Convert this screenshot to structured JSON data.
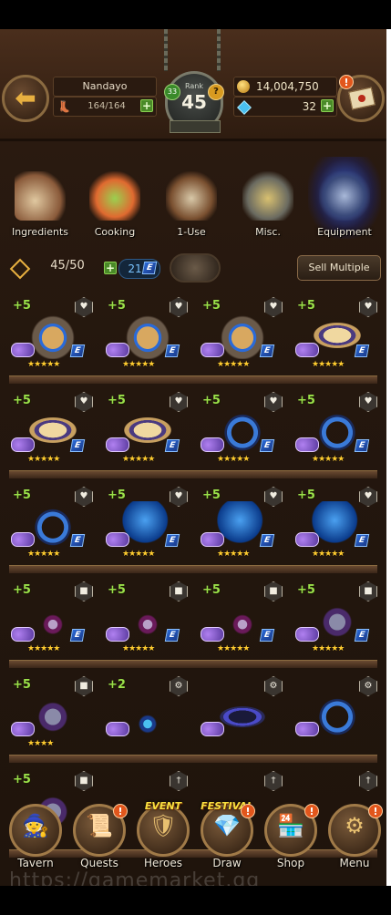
{
  "header": {
    "player_name": "Nandayo",
    "stamina": "164/164",
    "rank_label": "Rank",
    "rank": "45",
    "rank_badge_left": "33",
    "rank_badge_right": "?",
    "gold": "14,004,750",
    "gems": "32",
    "mail_alert": "!"
  },
  "categories": [
    {
      "label": "Ingredients"
    },
    {
      "label": "Cooking"
    },
    {
      "label": "1-Use"
    },
    {
      "label": "Misc."
    },
    {
      "label": "Equipment"
    }
  ],
  "inventory": {
    "slots": "45/50",
    "energy": "21",
    "energy_badge": "E",
    "sell_label": "Sell Multiple"
  },
  "items": [
    {
      "plus": "+5",
      "fav": "♥",
      "stars": "★★★★★",
      "type": "bracer"
    },
    {
      "plus": "+5",
      "fav": "♥",
      "stars": "★★★★★",
      "type": "bracer"
    },
    {
      "plus": "+5",
      "fav": "♥",
      "stars": "★★★★★",
      "type": "bracer"
    },
    {
      "plus": "+5",
      "fav": "♥",
      "stars": "★★★★★",
      "type": "belt"
    },
    {
      "plus": "+5",
      "fav": "♥",
      "stars": "★★★★★",
      "type": "belt"
    },
    {
      "plus": "+5",
      "fav": "♥",
      "stars": "★★★★★",
      "type": "belt"
    },
    {
      "plus": "+5",
      "fav": "♥",
      "stars": "★★★★★",
      "type": "ring"
    },
    {
      "plus": "+5",
      "fav": "♥",
      "stars": "★★★★★",
      "type": "ring"
    },
    {
      "plus": "+5",
      "fav": "♥",
      "stars": "★★★★★",
      "type": "ring"
    },
    {
      "plus": "+5",
      "fav": "♥",
      "stars": "★★★★★",
      "type": "orb"
    },
    {
      "plus": "+5",
      "fav": "♥",
      "stars": "★★★★★",
      "type": "orb"
    },
    {
      "plus": "+5",
      "fav": "♥",
      "stars": "★★★★★",
      "type": "orb"
    },
    {
      "plus": "+5",
      "fav": "■",
      "stars": "★★★★★",
      "type": "amulet"
    },
    {
      "plus": "+5",
      "fav": "■",
      "stars": "★★★★★",
      "type": "amulet"
    },
    {
      "plus": "+5",
      "fav": "■",
      "stars": "★★★★★",
      "type": "amulet"
    },
    {
      "plus": "+5",
      "fav": "■",
      "stars": "★★★★★",
      "type": "charm"
    },
    {
      "plus": "+5",
      "fav": "■",
      "stars": "★★★★",
      "type": "charm"
    },
    {
      "plus": "+2",
      "fav": "⚙",
      "stars": "",
      "type": "pendant"
    },
    {
      "plus": "",
      "fav": "⚙",
      "stars": "",
      "type": "bangle"
    },
    {
      "plus": "",
      "fav": "⚙",
      "stars": "",
      "type": "ring"
    },
    {
      "plus": "+5",
      "fav": "■",
      "stars": "",
      "type": "charm"
    },
    {
      "plus": "",
      "fav": "†",
      "stars": "",
      "type": "none"
    },
    {
      "plus": "",
      "fav": "†",
      "stars": "",
      "type": "none"
    },
    {
      "plus": "",
      "fav": "†",
      "stars": "",
      "type": "none"
    }
  ],
  "nav": [
    {
      "label": "Tavern",
      "alert": ""
    },
    {
      "label": "Quests",
      "alert": "!"
    },
    {
      "label": "Heroes",
      "alert": "",
      "banner": "EVENT"
    },
    {
      "label": "Draw",
      "alert": "!",
      "banner": "FESTIVAL"
    },
    {
      "label": "Shop",
      "alert": "!"
    },
    {
      "label": "Menu",
      "alert": "!"
    }
  ],
  "watermark": "https://gamemarket.gg"
}
